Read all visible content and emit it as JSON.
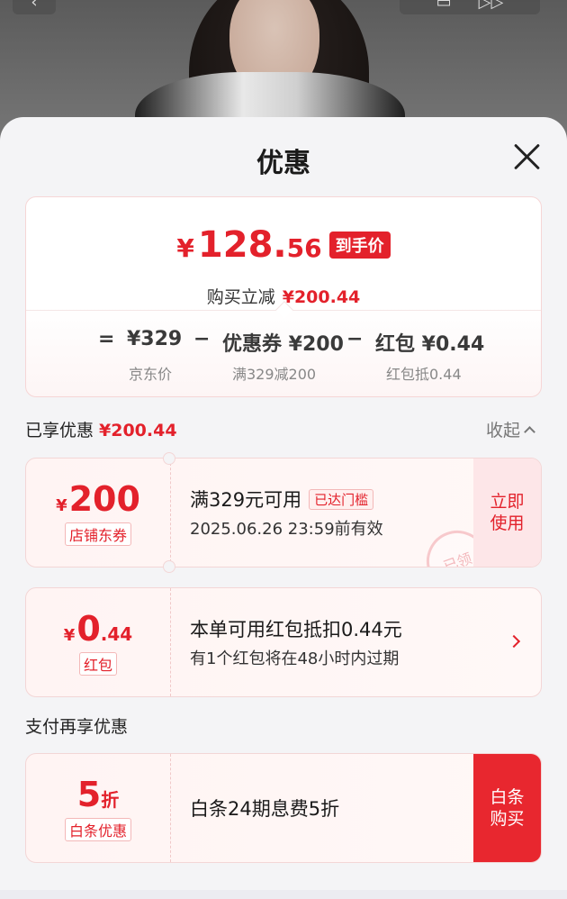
{
  "sheet": {
    "title": "优惠"
  },
  "summary": {
    "currency": "¥",
    "final_int": "128.",
    "final_dec": "56",
    "final_badge": "到手价",
    "discount_label": "购买立减",
    "discount_value": "¥200.44",
    "breakdown": {
      "eq": "=",
      "price": "¥329",
      "price_label": "京东价",
      "minus1": "−",
      "coupon": "优惠券 ¥200",
      "coupon_label": "满329减200",
      "minus2": "−",
      "redpacket": "红包 ¥0.44",
      "redpacket_label": "红包抵0.44"
    }
  },
  "enjoyed": {
    "label": "已享优惠",
    "value": "¥200.44",
    "collapse_label": "收起"
  },
  "coupons": [
    {
      "currency": "¥",
      "amount": "200",
      "amount_dec": "",
      "tag": "店铺东券",
      "line1": "满329元可用",
      "badge": "已达门槛",
      "line2": "2025.06.26 23:59前有效",
      "action": "立即\n使用",
      "stamp": "已领"
    },
    {
      "currency": "¥",
      "amount": "0",
      "amount_dec": ".44",
      "tag": "红包",
      "line1": "本单可用红包抵扣0.44元",
      "line2": "有1个红包将在48小时内过期"
    }
  ],
  "pay_section": {
    "label": "支付再享优惠",
    "card": {
      "amount": "5",
      "unit": "折",
      "tag": "白条优惠",
      "line1": "白条24期息费5折",
      "action": "白条\n购买"
    }
  },
  "colors": {
    "accent": "#e3212b",
    "buy_button": "#e8272f"
  }
}
